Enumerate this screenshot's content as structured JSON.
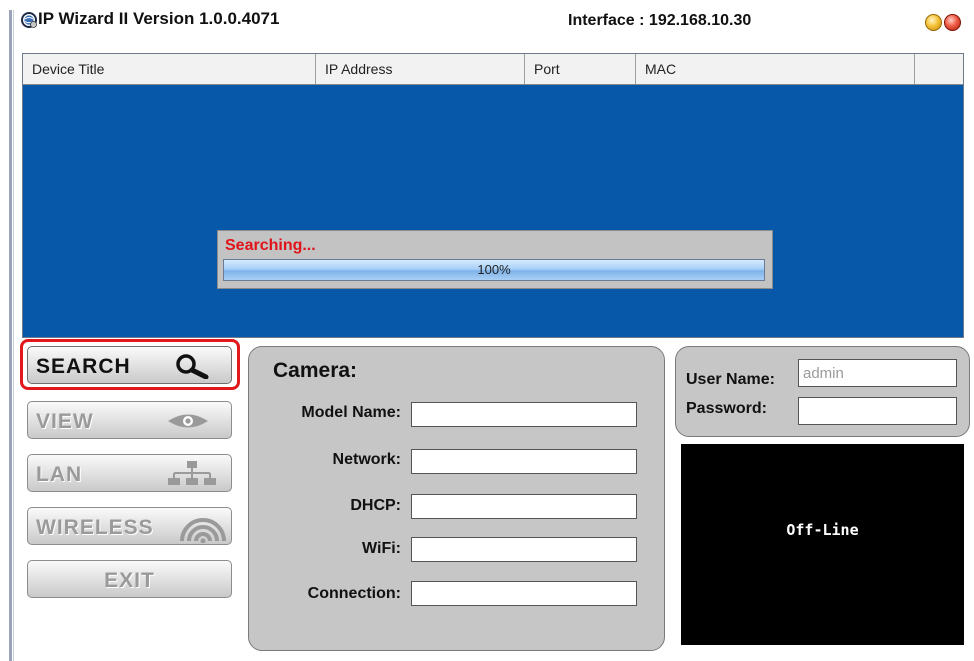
{
  "window": {
    "title": "IP Wizard II  Version 1.0.0.4071",
    "interface_label": "Interface : 192.168.10.30",
    "icons": {
      "app": "globe-gear-icon",
      "minimize": "yellow-circle-icon",
      "close": "red-circle-icon"
    }
  },
  "device_list": {
    "columns": [
      "Device Title",
      "IP Address",
      "Port",
      "MAC",
      ""
    ],
    "rows": []
  },
  "progress": {
    "label": "Searching...",
    "value_text": "100%",
    "fraction": 1.0
  },
  "buttons": {
    "search": {
      "label": "SEARCH",
      "icon": "magnifier-icon",
      "active": true
    },
    "view": {
      "label": "VIEW",
      "icon": "eye-icon",
      "active": false
    },
    "lan": {
      "label": "LAN",
      "icon": "network-tree-icon",
      "active": false
    },
    "wireless": {
      "label": "WIRELESS",
      "icon": "wifi-icon",
      "active": false
    },
    "exit": {
      "label": "EXIT",
      "active": false
    }
  },
  "camera": {
    "title": "Camera:",
    "fields": [
      {
        "label": "Model Name:",
        "value": ""
      },
      {
        "label": "Network:",
        "value": ""
      },
      {
        "label": "DHCP:",
        "value": ""
      },
      {
        "label": "WiFi:",
        "value": ""
      },
      {
        "label": "Connection:",
        "value": ""
      }
    ]
  },
  "login": {
    "username_label": "User Name:",
    "username_value": "admin",
    "password_label": "Password:",
    "password_value": ""
  },
  "video": {
    "status": "Off-Line"
  },
  "colors": {
    "list_background": "#0758a8",
    "highlight": "#e1181c",
    "searching_text": "#e0141b",
    "panel": "#c6c6c6"
  }
}
